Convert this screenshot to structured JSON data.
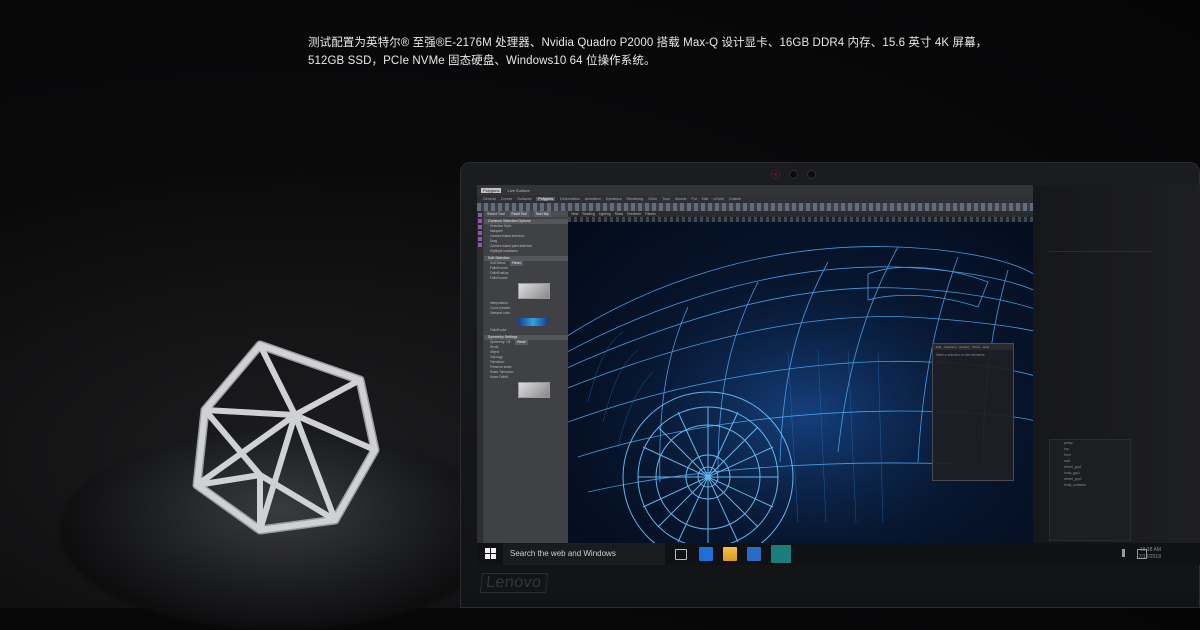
{
  "caption": {
    "line1": "测试配置为英特尔® 至强®E-2176M 处理器、Nvidia Quadro P2000 搭载 Max-Q 设计显卡、16GB DDR4 内存、15.6 英寸 4K 屏幕，",
    "line2": "512GB SSD，PCIe NVMe 固态硬盘、Windows10 64 位操作系统。"
  },
  "laptop": {
    "brand": "Lenovo"
  },
  "app": {
    "menus": [
      "Polygons",
      "General",
      "Curves",
      "Surfaces",
      "Polygons",
      "Deformation",
      "Animation",
      "Dynamics",
      "Rendering",
      "XGen",
      "Toon",
      "Muscle",
      "Fur",
      "Hair",
      "nCloth",
      "Custom"
    ],
    "selected_menu": "Live Surface",
    "panel_title": "Select Tool",
    "panel_buttons": [
      "Reset Tool",
      "Tool Help"
    ],
    "sections": {
      "common": "Common Selection Options",
      "soft": "Soft Selection",
      "symmetry": "Symmetry Settings"
    },
    "rows": {
      "selection_style": "Selection Style:",
      "marquee": "Marquee",
      "camera_based": "Camera based selection",
      "drag": "Drag",
      "camera_paint": "Camera based paint selection",
      "highlight": "Highlight backfaces",
      "soft_select": "Soft Select",
      "falloff_mode": "Falloff mode:",
      "falloff_radius": "Falloff radius:",
      "falloff_curve": "Falloff curve:",
      "interpolation": "Interpolation:",
      "curve_presets": "Curve presets:",
      "viewport_color": "Viewport color",
      "falloff_color": "Falloff color",
      "symmetry": "Symmetry:",
      "off": "Off",
      "world": "World",
      "object": "Object",
      "topology": "Topology",
      "tolerance": "Tolerance:",
      "preserve_seam": "Preserve seam",
      "seam_tolerance": "Seam Tolerance:",
      "seam_falloff": "Seam Falloff:"
    },
    "reset_label": "Reset",
    "viewport_menus": [
      "View",
      "Shading",
      "Lighting",
      "Show",
      "Renderer",
      "Panels"
    ],
    "dialog_tabs": [
      "Edit",
      "Selection",
      "Display",
      "Show",
      "Help"
    ],
    "dialog_hint": "Make a selection to view elements",
    "outliner_items": [
      "persp",
      "top",
      "front",
      "side",
      "wheel_grp1",
      "body_grp1",
      "wheel_grp2",
      "body_surfaces"
    ]
  },
  "taskbar": {
    "search_placeholder": "Search the web and Windows",
    "time": "10:38 AM",
    "date": "7/12/2018"
  },
  "colors": {
    "wire_blue": "#4fb3ff",
    "taskbar": "#101114",
    "accent_blue": "#1e6fd8"
  }
}
